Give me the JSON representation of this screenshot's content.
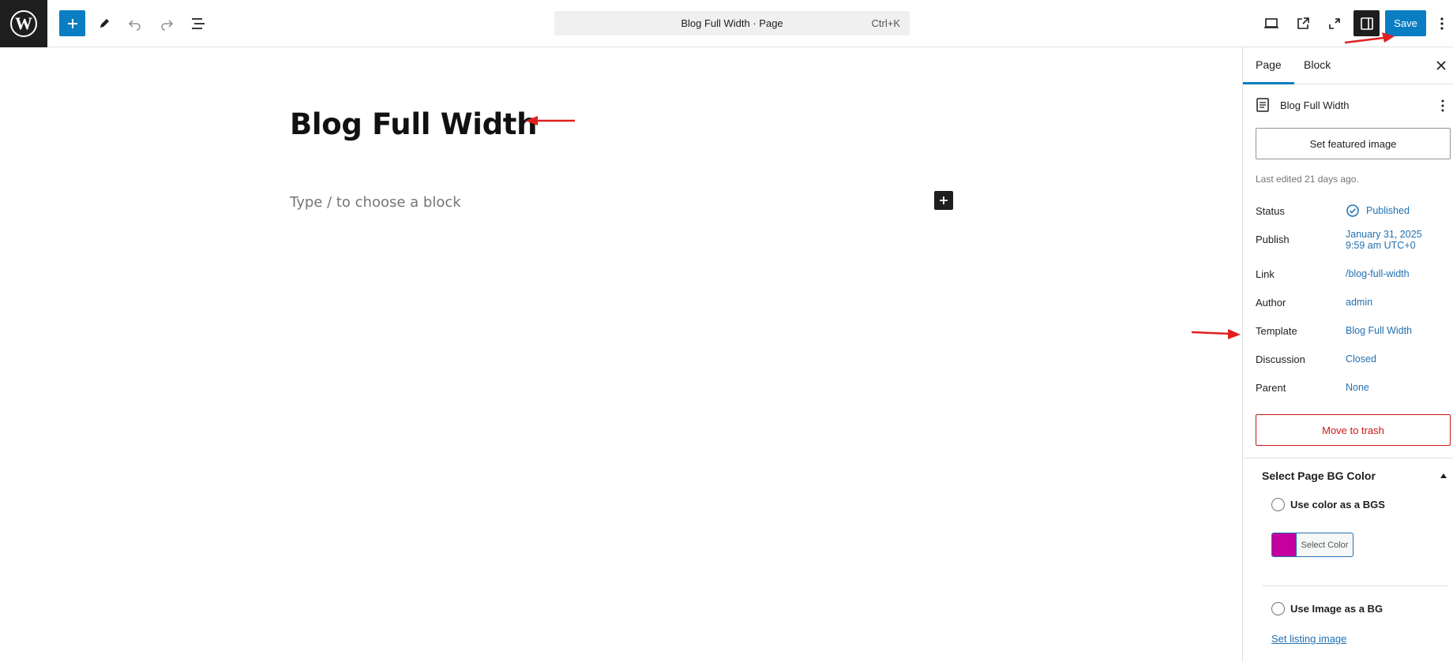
{
  "topbar": {
    "logo": "wordpress-logo",
    "add_block_icon": "plus-icon",
    "tools_icon": "pencil-icon",
    "undo_icon": "undo-icon",
    "redo_icon": "redo-icon",
    "document_overview_icon": "list-view-icon",
    "command_title": "Blog Full Width · Page",
    "command_shortcut": "Ctrl+K",
    "view_icon": "desktop-icon",
    "preview_icon": "external-link-icon",
    "fullscreen_icon": "fullscreen-icon",
    "sidebar_icon": "sidebar-icon",
    "save_label": "Save",
    "options_icon": "more-vertical-icon"
  },
  "editor": {
    "title": "Blog Full Width",
    "placeholder": "Type / to choose a block"
  },
  "sidebar": {
    "tabs": [
      {
        "label": "Page",
        "active": true
      },
      {
        "label": "Block",
        "active": false
      }
    ],
    "document_title": "Blog Full Width",
    "featured_image_label": "Set featured image",
    "last_edited": "Last edited 21 days ago.",
    "meta": {
      "status": {
        "label": "Status",
        "value": "Published"
      },
      "publish": {
        "label": "Publish",
        "value_line1": "January 31, 2025",
        "value_line2": "9:59 am UTC+0"
      },
      "link": {
        "label": "Link",
        "value": "/blog-full-width"
      },
      "author": {
        "label": "Author",
        "value": "admin"
      },
      "template": {
        "label": "Template",
        "value": "Blog Full Width"
      },
      "discussion": {
        "label": "Discussion",
        "value": "Closed"
      },
      "parent": {
        "label": "Parent",
        "value": "None"
      }
    },
    "trash_label": "Move to trash",
    "bg_panel": {
      "title": "Select Page BG Color",
      "option_color": "Use color as a BGS",
      "select_color_label": "Select Color",
      "swatch_color": "#c5009f",
      "option_image": "Use Image as a BG",
      "listing_link": "Set listing image"
    }
  },
  "colors": {
    "accent": "#0a7ec2",
    "link": "#2271b1",
    "danger": "#cc1818",
    "annotation": "#e02020"
  }
}
